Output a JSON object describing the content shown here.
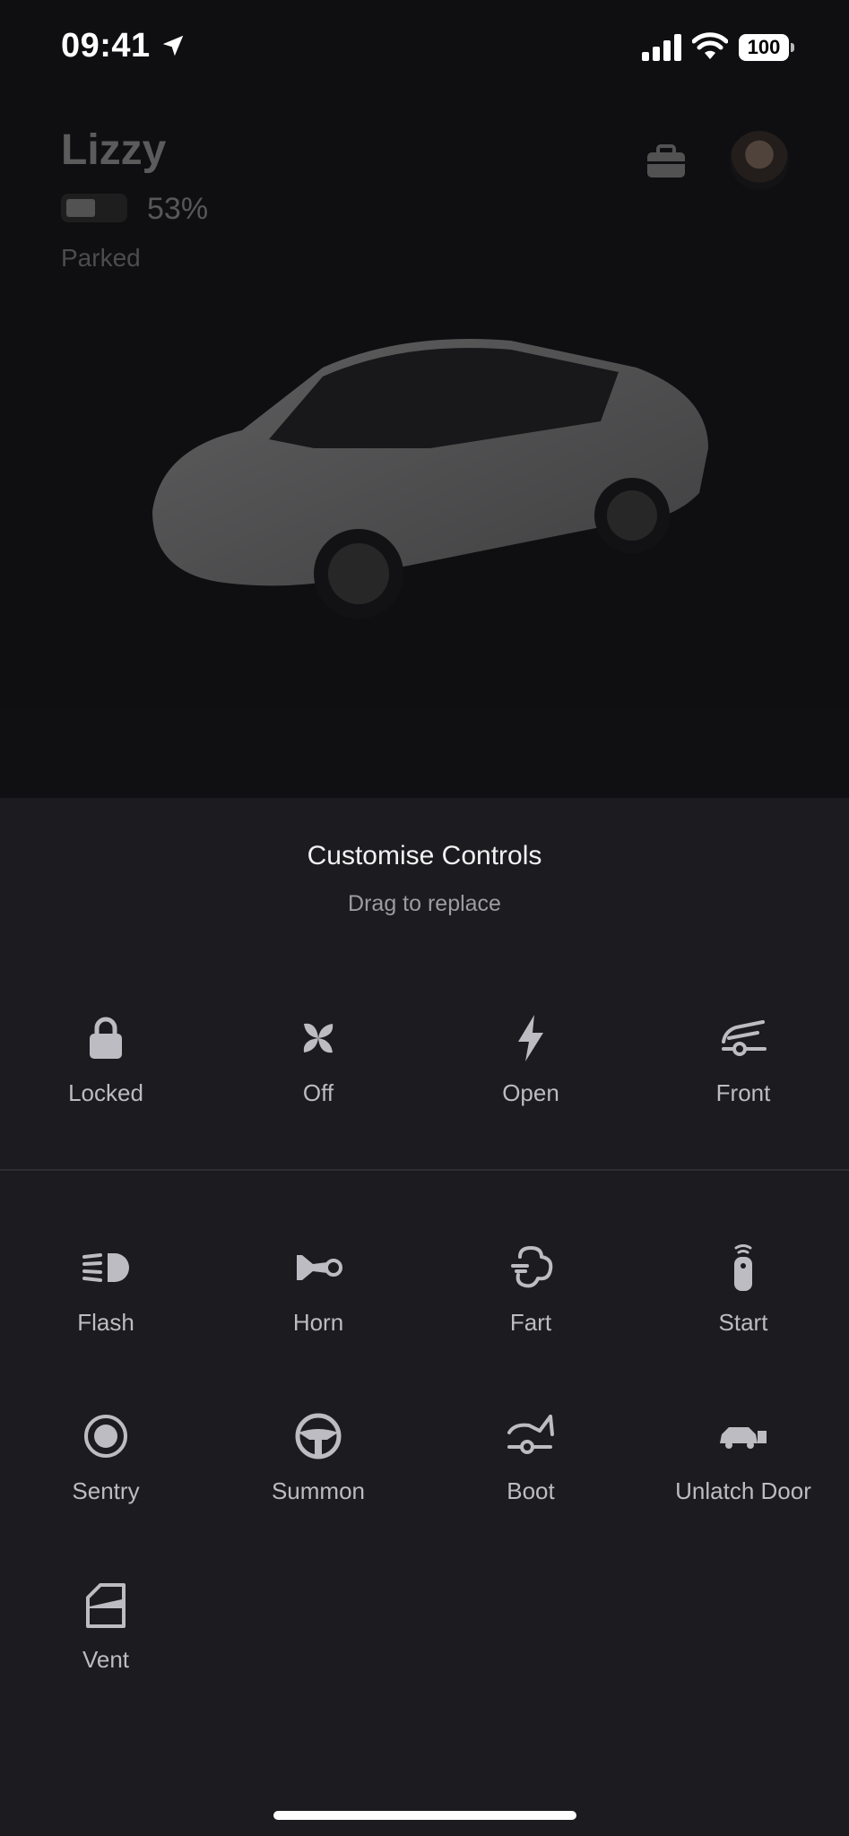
{
  "status_bar": {
    "time": "09:41",
    "battery": "100"
  },
  "vehicle": {
    "name": "Lizzy",
    "battery_percent_text": "53%",
    "battery_level": 0.53,
    "state": "Parked"
  },
  "sheet": {
    "title": "Customise Controls",
    "subtitle": "Drag to replace",
    "active_controls": [
      {
        "label": "Locked",
        "icon": "lock-icon"
      },
      {
        "label": "Off",
        "icon": "fan-icon"
      },
      {
        "label": "Open",
        "icon": "lightning-icon"
      },
      {
        "label": "Front",
        "icon": "frunk-icon"
      }
    ],
    "available_controls": [
      {
        "label": "Flash",
        "icon": "headlight-icon"
      },
      {
        "label": "Horn",
        "icon": "horn-icon"
      },
      {
        "label": "Fart",
        "icon": "fart-icon"
      },
      {
        "label": "Start",
        "icon": "key-fob-icon"
      },
      {
        "label": "Sentry",
        "icon": "sentry-icon"
      },
      {
        "label": "Summon",
        "icon": "steering-wheel-icon"
      },
      {
        "label": "Boot",
        "icon": "trunk-icon"
      },
      {
        "label": "Unlatch Door",
        "icon": "car-door-icon"
      },
      {
        "label": "Vent",
        "icon": "window-vent-icon"
      }
    ]
  },
  "colors": {
    "sheet_background": "#1c1b1f",
    "page_background": "#0f0f11",
    "label_color": "#bcbcc2",
    "icon_color": "#bcbcc2"
  }
}
